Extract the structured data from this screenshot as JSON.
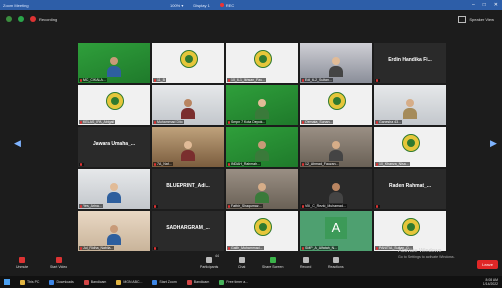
{
  "window": {
    "app_title": "Zoom Meeting",
    "center_items": [
      "100% ▾",
      "Display 1",
      "REC"
    ],
    "controls": [
      "–",
      "□",
      "✕"
    ]
  },
  "topbar": {
    "recording_label": "Recording",
    "speaker_view_label": "Speaker View"
  },
  "tiles": [
    {
      "label": "MC_CIKALA...",
      "bg": "bg-green",
      "kind": "person"
    },
    {
      "label": "11_B",
      "bg": "bg-white-green",
      "kind": "logo"
    },
    {
      "label": "10_6-1_Ikhsan_Fau...",
      "bg": "bg-white-green",
      "kind": "logo"
    },
    {
      "label": "Edi_6-2_Sultan...",
      "bg": "bg-room2",
      "kind": "person"
    },
    {
      "label": "",
      "bg": "bg-dark",
      "kind": "name",
      "name": "Erdin Handika Fi..."
    },
    {
      "label": "KELAS_IPA_Abigail",
      "bg": "bg-white-green",
      "kind": "logo"
    },
    {
      "label": "Muhammad Dito",
      "bg": "bg-light",
      "kind": "person"
    },
    {
      "label": "Smpn 7 Kota Depok...",
      "bg": "bg-green",
      "kind": "person"
    },
    {
      "label": "Oemata_Sunan...",
      "bg": "bg-white-green",
      "kind": "logo"
    },
    {
      "label": "Ganesha 43...",
      "bg": "bg-light",
      "kind": "person"
    },
    {
      "label": "",
      "bg": "bg-dark",
      "kind": "name",
      "name": "Jawara Umaha_..."
    },
    {
      "label": "7A_Naf...",
      "bg": "bg-door",
      "kind": "person"
    },
    {
      "label": "INDAH_Rahmah...",
      "bg": "bg-green",
      "kind": "person"
    },
    {
      "label": "12_Ahmad_Fauzan...",
      "bg": "bg-room",
      "kind": "person"
    },
    {
      "label": "10_Khanza_Nisa...",
      "bg": "bg-white-green",
      "kind": "logo"
    },
    {
      "label": "Yes_Arina...",
      "bg": "bg-light",
      "kind": "person"
    },
    {
      "label": "",
      "bg": "bg-dark",
      "kind": "name",
      "name": "BLUEPRINT_Adi..."
    },
    {
      "label": "Fathir_Shaqumaz...",
      "bg": "bg-room",
      "kind": "person"
    },
    {
      "label": "VIII_C_Rezki_Muhamad...",
      "bg": "bg-dark",
      "kind": "person"
    },
    {
      "label": "",
      "bg": "bg-dark",
      "kind": "name",
      "name": "Raden Rahmat_..."
    },
    {
      "label": "Jul_Ridha_Nabila...",
      "bg": "bg-wall",
      "kind": "person"
    },
    {
      "label": "",
      "bg": "bg-dark",
      "kind": "name",
      "name": "SADHARGRAM_..."
    },
    {
      "label": "Galih_Muhammad...",
      "bg": "bg-white-green",
      "kind": "logo"
    },
    {
      "label": "SMP_A_Alfatah_N...",
      "bg": "bg-teal",
      "kind": "avatar",
      "letter": "A"
    },
    {
      "label": "PANITIA_Sultan_G...",
      "bg": "bg-white-green",
      "kind": "logo"
    }
  ],
  "bottombar": {
    "unmute": "Unmute",
    "start_video": "Start Video",
    "participants": "Participants",
    "participants_count": "44",
    "chat": "Chat",
    "share_screen": "Share Screen",
    "record": "Record",
    "reactions": "Reactions",
    "leave": "Leave"
  },
  "activation": {
    "title": "Activate Windows",
    "subtitle": "Go to Settings to activate Windows."
  },
  "taskbar": {
    "items": [
      "This PC",
      "Downloads",
      "Bandicam",
      "MGN ABC...",
      "Start Zoom",
      "Bandicam",
      "Free timer a..."
    ],
    "time": "8:08 AM",
    "date": "1/14/2022"
  },
  "colors": {
    "titlebar": "#2d5ea8",
    "leave": "#e02727",
    "tile_green": "#2f9f3b"
  }
}
